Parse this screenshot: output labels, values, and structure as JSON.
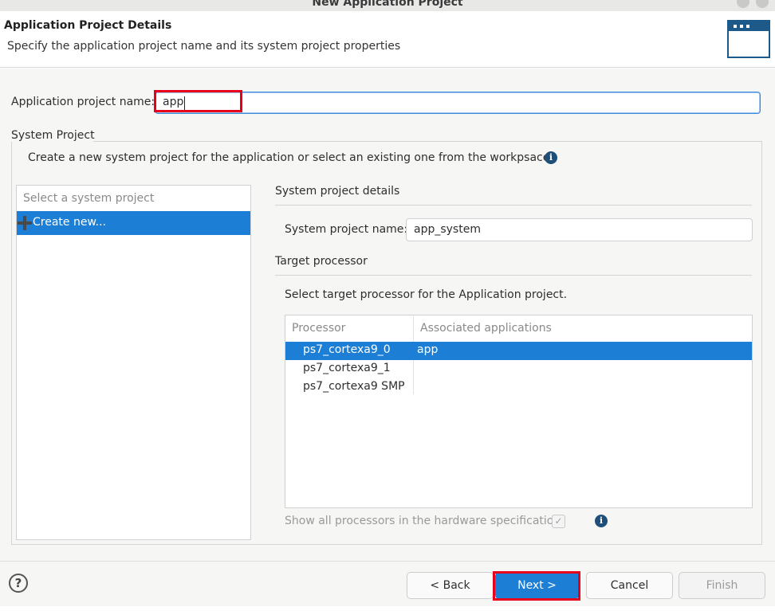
{
  "window": {
    "title": "New Application Project"
  },
  "header": {
    "title": "Application Project Details",
    "description": "Specify the application project name and its system project properties"
  },
  "app_project": {
    "label": "Application project name:",
    "value": "app"
  },
  "system_project": {
    "group_label": "System Project",
    "description": "Create a new system project for the application or select an existing one from the workpsace",
    "list": {
      "placeholder": "Select a system project",
      "items": [
        {
          "label": "Create new...",
          "selected": true
        }
      ]
    },
    "details": {
      "heading": "System project details",
      "name_label": "System project name:",
      "name_value": "app_system"
    },
    "target": {
      "heading": "Target processor",
      "instruction": "Select target processor for the Application project.",
      "columns": [
        "Processor",
        "Associated applications"
      ],
      "rows": [
        {
          "processor": "ps7_cortexa9_0",
          "apps": "app",
          "selected": true
        },
        {
          "processor": "ps7_cortexa9_1",
          "apps": "",
          "selected": false
        },
        {
          "processor": "ps7_cortexa9 SMP",
          "apps": "",
          "selected": false
        }
      ],
      "show_all_label": "Show all processors in the hardware specification",
      "show_all_checked": true
    }
  },
  "buttons": {
    "back": "< Back",
    "next": "Next >",
    "cancel": "Cancel",
    "finish": "Finish",
    "help": "?"
  },
  "colors": {
    "selection": "#1c7fd5",
    "highlight_box": "#e8001b",
    "info_icon": "#1f4e79"
  },
  "icons": {
    "info": "info-icon",
    "plus": "plus-icon",
    "help": "help-icon",
    "wizard": "wizard-banner-icon"
  }
}
